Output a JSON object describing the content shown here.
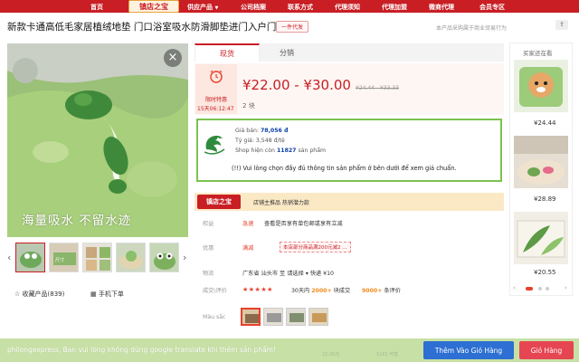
{
  "nav": {
    "home": "首页",
    "logo": "镇店之宝",
    "supply": "供应产品",
    "company": "公司档案",
    "contact": "联系方式",
    "agent_notice": "代理须知",
    "agent_join": "代理加盟",
    "wechat_agent": "微商代理",
    "member": "会员专区"
  },
  "product": {
    "title": "新款卡通高低毛家居植绒地垫 门口浴室吸水防滑脚垫进门入户门垫",
    "badge": "一件代发",
    "note": "本产品采购属于商业贸易行为",
    "image_caption": "海量吸水 不留水迹",
    "favorite": "收藏产品(839)",
    "mobile_order": "手机下单"
  },
  "tabs": {
    "now": "现货",
    "split": "分销"
  },
  "price": {
    "timer_label": "限时特惠",
    "timer_time": "15天06:12:47",
    "main": "¥22.00 - ¥30.00",
    "old": "¥24.44 - ¥33.33",
    "sub_num": "2",
    "sub_unit": "块"
  },
  "vn_box": {
    "line1_label": "Giá bán:",
    "line1_value": "78,056 đ",
    "line2": "Tỷ giá: 3,548 đ/tệ",
    "line3_pre": "Shop hiện còn",
    "line3_num": "11827",
    "line3_post": "sản phẩm",
    "warning": "(!!) Vui lòng chọn đầy đủ thông tin sản phẩm ở bên dưới để xem giá chuẩn."
  },
  "shop": {
    "logo": "镇店之宝",
    "text": "店铺主推品  热销潜力款"
  },
  "rows": {
    "rights_label": "权益",
    "rights_tag": "急速",
    "rights_text": "查看是否享有单包邮或享有立减",
    "promo_label": "优惠",
    "promo_tag": "满减",
    "promo_text": "本店部分商品满200元减2 ...",
    "logistics_label": "物流",
    "logistics_text": "广东省 汕头市  至  请选择  ▾    快递 ¥10",
    "deal_label": "成交\\评价",
    "stars": "★★★★★",
    "deal_days": "30天内",
    "deal_num": "2000+",
    "deal_unit": "块成交",
    "review_num": "9000+",
    "review_unit": "条评价",
    "color_label": "Màu sắc"
  },
  "side": {
    "title": "买家还在看",
    "prices": [
      "¥24.44",
      "¥28.89",
      "¥20.55"
    ]
  },
  "bottom": {
    "notice": "philongexpress, Bạn vui lòng không dùng google translate khi thêm sản phẩm!",
    "cart_button": "Thêm Vào Giỏ Hàng",
    "buy_button": "Giỏ Hàng",
    "ghost1": "22.00元",
    "ghost2": "1161 可售"
  },
  "colors": {
    "brand_red": "#c81e24",
    "green_border": "#7cc14f",
    "cart_blue": "#2d6fd2",
    "buy_red": "#e64552"
  }
}
